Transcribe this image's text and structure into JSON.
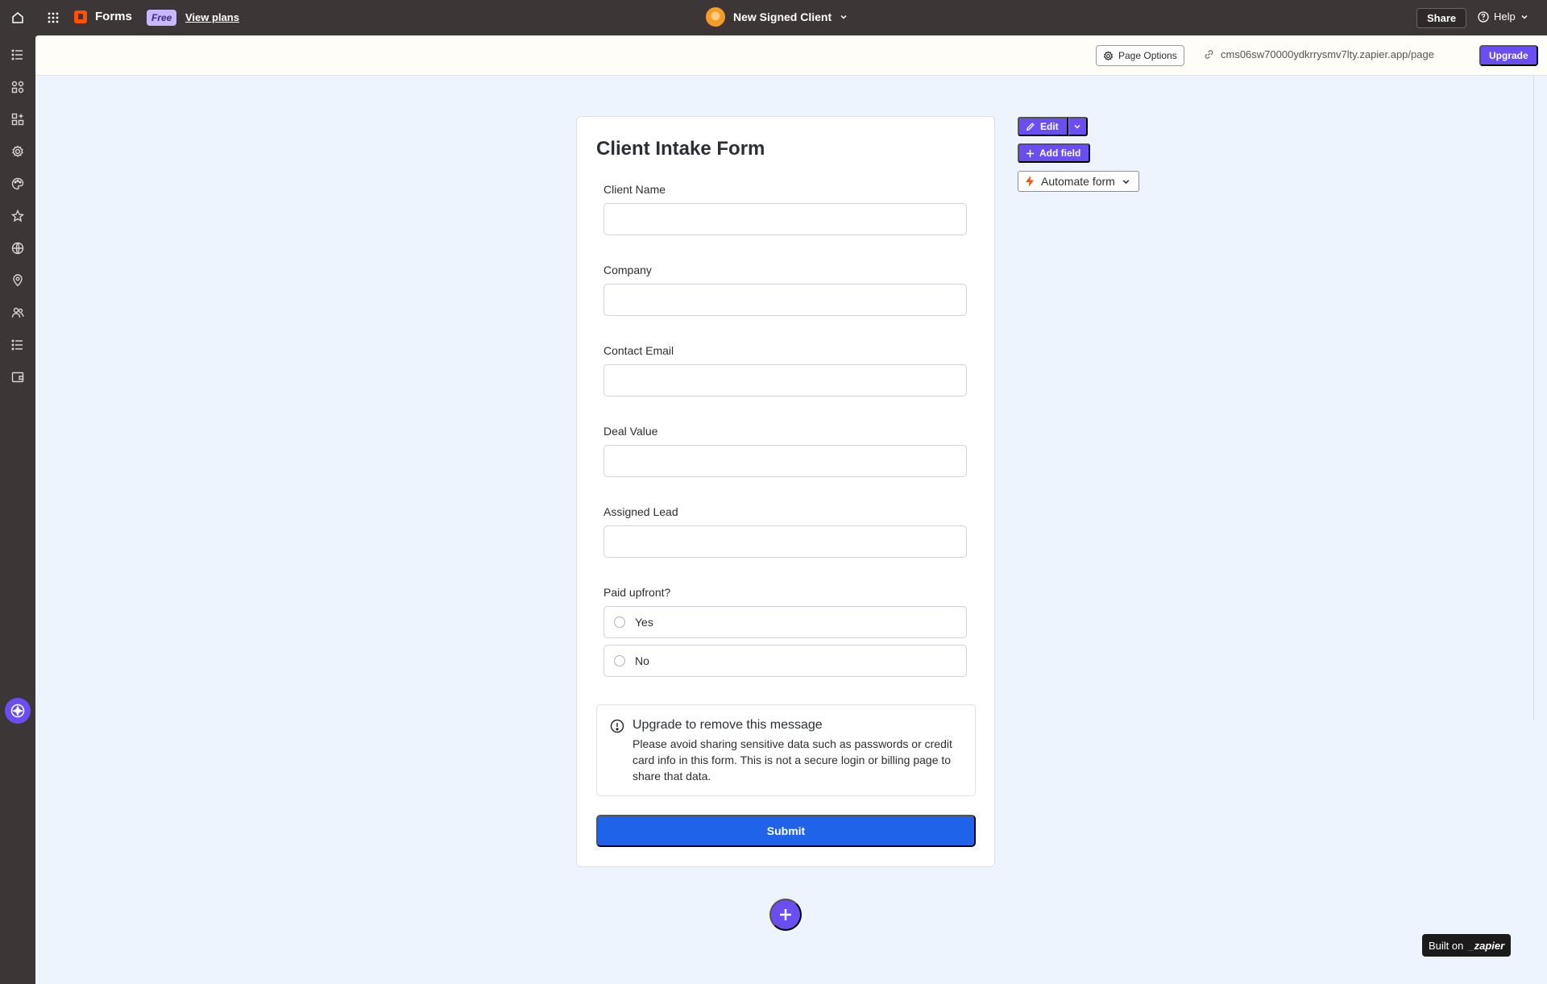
{
  "topbar": {
    "brand": "Forms",
    "plan_badge": "Free",
    "view_plans": "View plans",
    "project_name": "New Signed Client",
    "share": "Share",
    "help": "Help"
  },
  "rail": {
    "icons": [
      "list-icon",
      "components-icon",
      "add-widget-icon",
      "settings-icon",
      "palette-icon",
      "star-icon",
      "globe-icon",
      "location-pin-icon",
      "users-icon",
      "list-detail-icon",
      "wallet-icon",
      "assistant-icon"
    ]
  },
  "subbar": {
    "page_options": "Page Options",
    "url": "cms06sw70000ydkrrysmv7lty.zapier.app/page",
    "upgrade": "Upgrade"
  },
  "form": {
    "title": "Client Intake Form",
    "fields": [
      {
        "label": "Client Name",
        "value": ""
      },
      {
        "label": "Company",
        "value": ""
      },
      {
        "label": "Contact Email",
        "value": ""
      },
      {
        "label": "Deal Value",
        "value": ""
      },
      {
        "label": "Assigned Lead",
        "value": ""
      }
    ],
    "radio": {
      "label": "Paid upfront?",
      "options": [
        "Yes",
        "No"
      ]
    },
    "notice": {
      "title": "Upgrade to remove this message",
      "body": "Please avoid sharing sensitive data such as passwords or credit card info in this form. This is not a secure login or billing page to share that data."
    },
    "submit": "Submit"
  },
  "actions": {
    "edit": "Edit",
    "add_field": "Add field",
    "automate": "Automate form"
  },
  "footer": {
    "built_on": "Built on",
    "zapier": "zapier"
  },
  "colors": {
    "accent": "#6b4ef2",
    "submit": "#1f63e8",
    "brand": "#ff4f00",
    "background": "#eef4fd",
    "chrome": "#3d3637"
  }
}
